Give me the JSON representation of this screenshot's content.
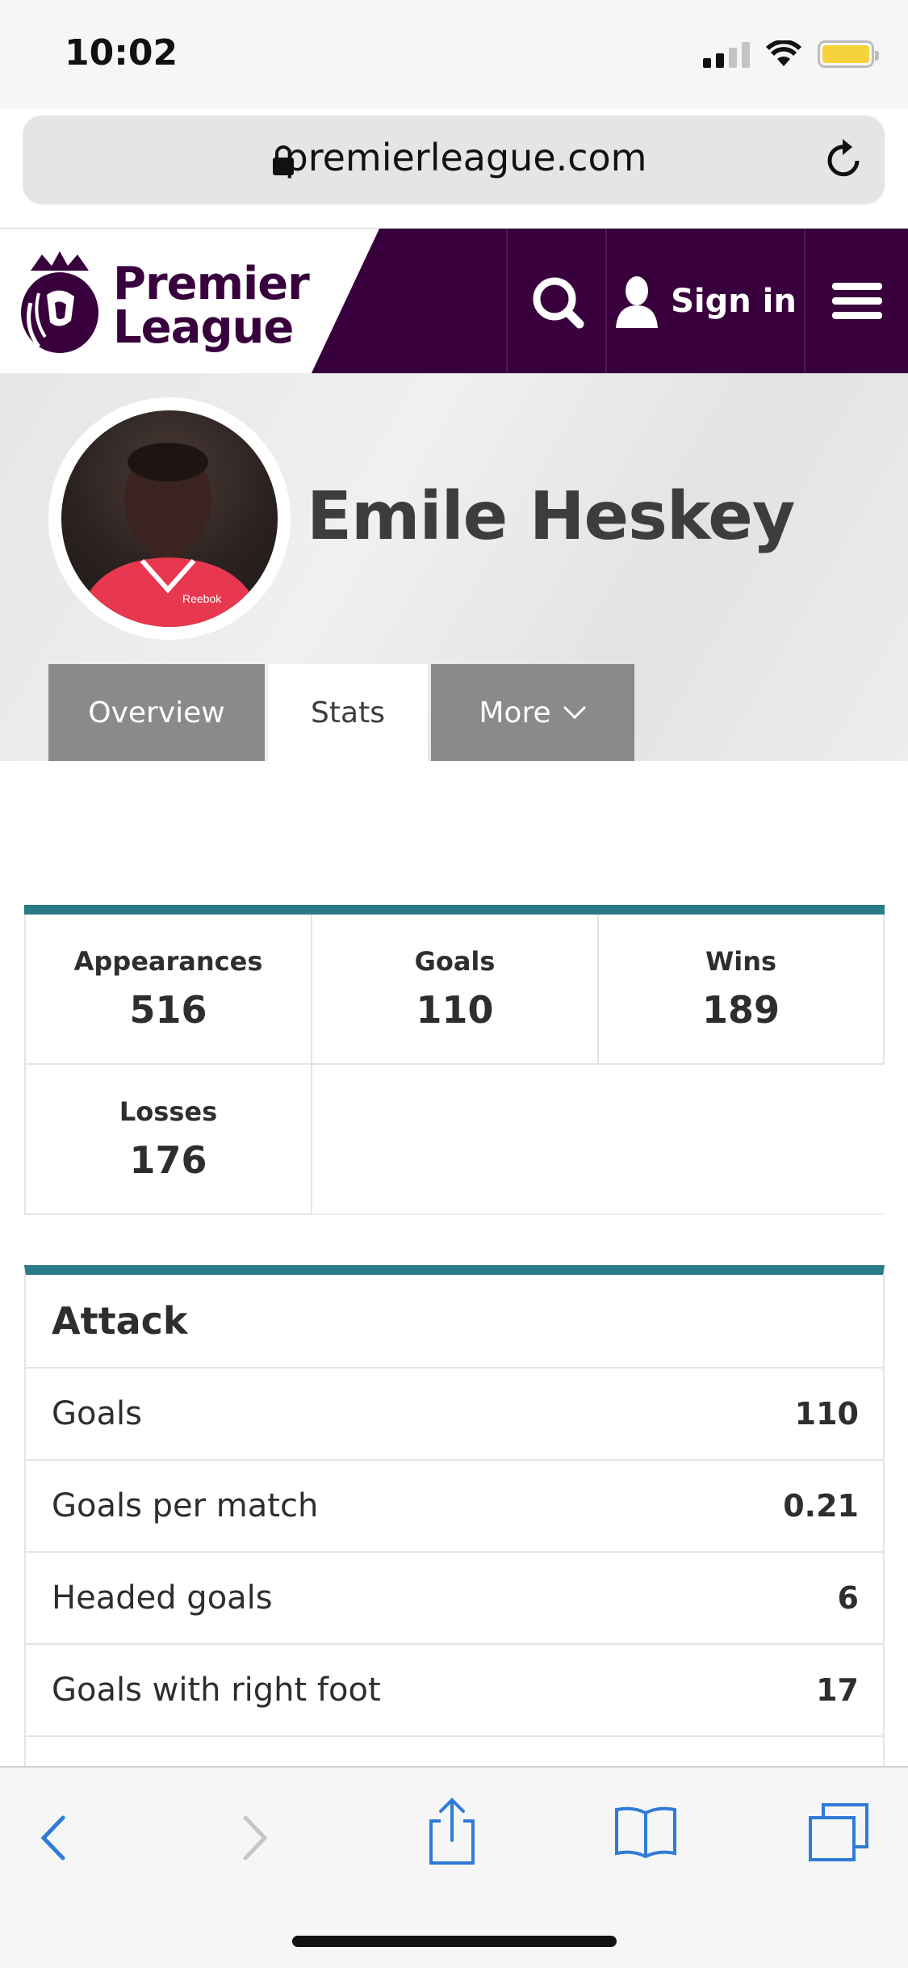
{
  "status_bar": {
    "time": "10:02"
  },
  "browser": {
    "url": "premierleague.com"
  },
  "header": {
    "logo_line1": "Premier",
    "logo_line2": "League",
    "sign_in_label": "Sign in"
  },
  "player": {
    "name": "Emile Heskey",
    "photo_badge_text": "Reebok"
  },
  "tabs": [
    {
      "label": "Overview",
      "active": false
    },
    {
      "label": "Stats",
      "active": true
    },
    {
      "label": "More",
      "active": false
    }
  ],
  "top_stats": [
    {
      "label": "Appearances",
      "value": "516"
    },
    {
      "label": "Goals",
      "value": "110"
    },
    {
      "label": "Wins",
      "value": "189"
    },
    {
      "label": "Losses",
      "value": "176"
    }
  ],
  "attack": {
    "title": "Attack",
    "rows": [
      {
        "label": "Goals",
        "value": "110"
      },
      {
        "label": "Goals per match",
        "value": "0.21"
      },
      {
        "label": "Headed goals",
        "value": "6"
      },
      {
        "label": "Goals with right foot",
        "value": "17"
      }
    ]
  },
  "colors": {
    "brand_purple": "#38003c",
    "section_accent": "#2a7a88",
    "tab_inactive": "#8a8a8a",
    "ios_blue": "#2f7bd8"
  },
  "toolbar_icons": [
    "back-icon",
    "forward-icon",
    "share-icon",
    "bookmarks-icon",
    "tabs-icon"
  ]
}
